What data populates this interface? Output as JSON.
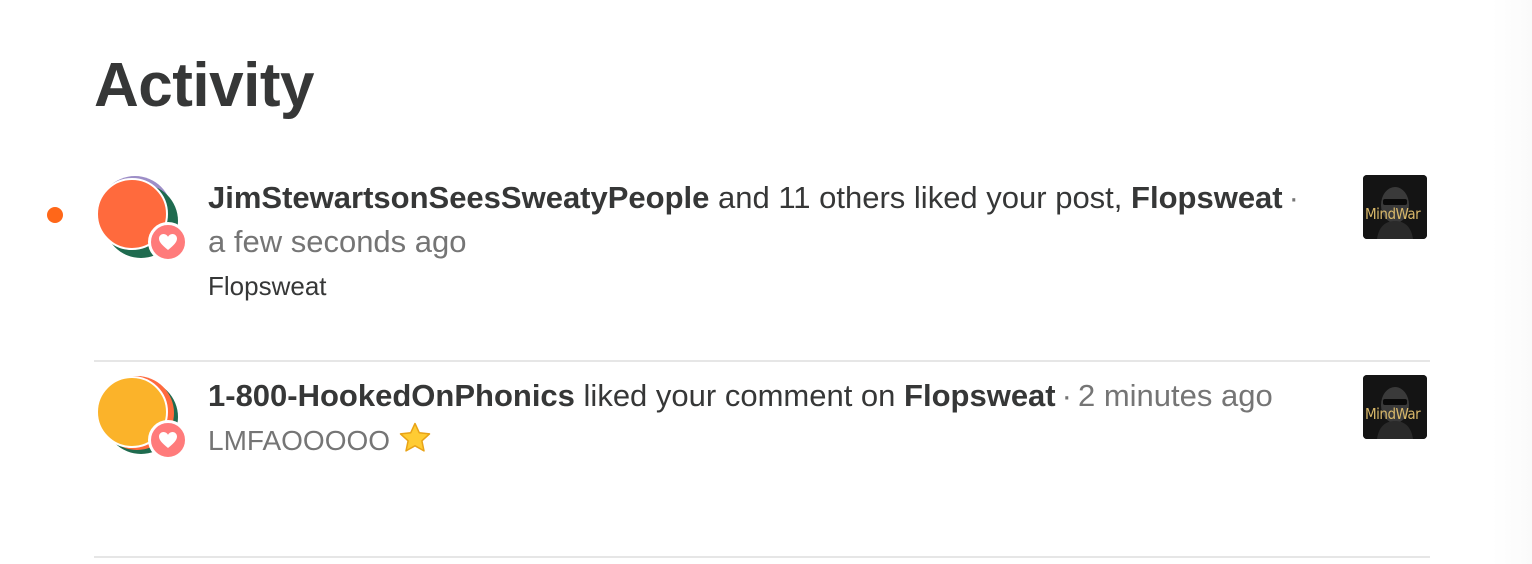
{
  "page": {
    "title": "Activity"
  },
  "colors": {
    "accent": "#ff6719",
    "heart": "#ff7b7b",
    "text": "#363737",
    "muted": "#757575"
  },
  "activities": [
    {
      "unread": true,
      "icon": "heart-icon",
      "actor": "JimStewartsonSeesSweatyPeople",
      "action": "and 11 others liked your post,",
      "post_title": "Flopsweat",
      "separator": "·",
      "timestamp": "a few seconds ago",
      "excerpt": "Flopsweat",
      "thumbnail_text": "MindWar"
    },
    {
      "unread": false,
      "icon": "heart-icon",
      "actor": "1-800-HookedOnPhonics",
      "action": "liked your comment on",
      "post_title": "Flopsweat",
      "separator": "·",
      "timestamp": "2 minutes ago",
      "excerpt": "LMFAOOOOO",
      "excerpt_icon": "star-emoji-icon",
      "thumbnail_text": "MindWar"
    }
  ]
}
